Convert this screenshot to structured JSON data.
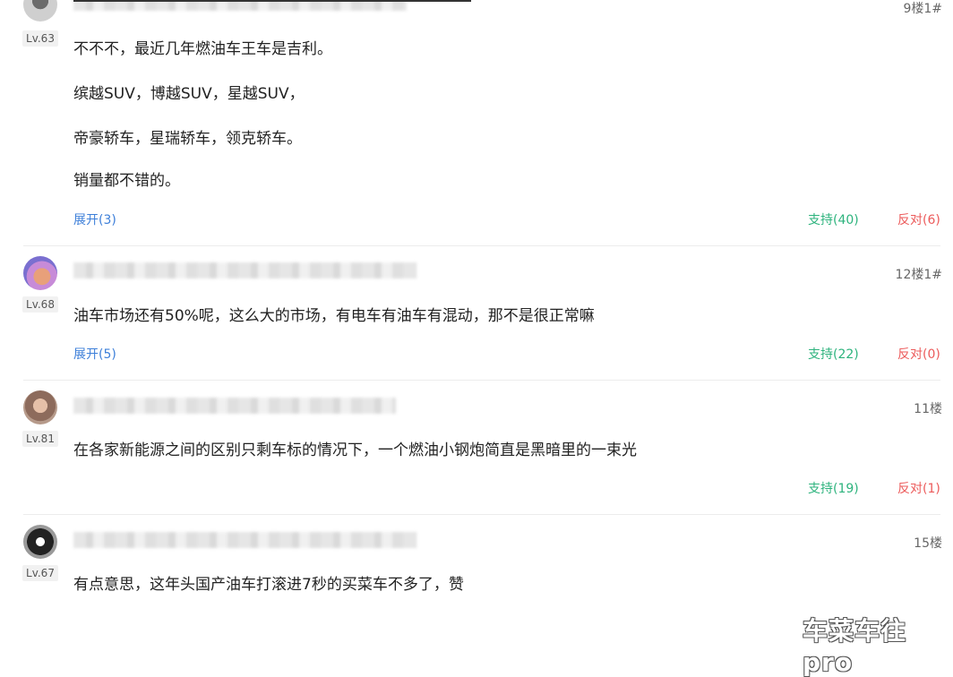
{
  "comments": [
    {
      "level": "Lv.63",
      "floor": "9楼1#",
      "lines": [
        "不不不，最近几年燃油车王车是吉利。",
        "缤越SUV，博越SUV，星越SUV，",
        "帝豪轿车，星瑞轿车，领克轿车。",
        "销量都不错的。"
      ],
      "expand": "展开(3)",
      "support": "支持(40)",
      "oppose": "反对(6)"
    },
    {
      "level": "Lv.68",
      "floor": "12楼1#",
      "lines": [
        "油车市场还有50%呢，这么大的市场，有电车有油车有混动，那不是很正常嘛"
      ],
      "expand": "展开(5)",
      "support": "支持(22)",
      "oppose": "反对(0)"
    },
    {
      "level": "Lv.81",
      "floor": "11楼",
      "lines": [
        "在各家新能源之间的区别只剩车标的情况下，一个燃油小钢炮简直是黑暗里的一束光"
      ],
      "support": "支持(19)",
      "oppose": "反对(1)"
    },
    {
      "level": "Lv.67",
      "floor": "15楼",
      "lines": [
        "有点意思，这年头国产油车打滚进7秒的买菜车不多了，赞"
      ]
    }
  ],
  "watermark": "车菜车往pro"
}
